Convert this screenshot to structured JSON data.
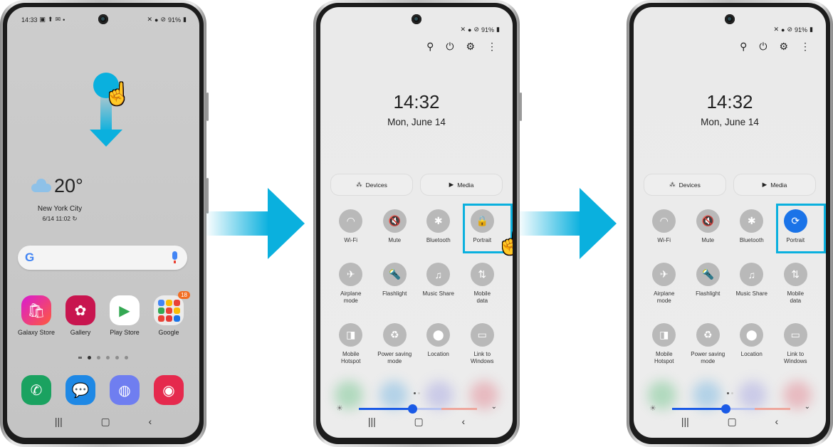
{
  "colors": {
    "accent": "#0ab0de",
    "toggle_on": "#1a73e8",
    "badge": "#f26d22"
  },
  "phone1": {
    "status_time": "14:33",
    "status_icons_left": [
      "image-icon",
      "upload-icon",
      "mail-icon",
      "dot-icon"
    ],
    "status_right": "91%",
    "gesture": "swipe-down",
    "weather": {
      "temp": "20°",
      "city": "New York City",
      "updated": "6/14 11:02"
    },
    "apps": [
      {
        "label": "Galaxy Store",
        "icon": "bag-icon",
        "color": "#e3336f"
      },
      {
        "label": "Gallery",
        "icon": "flower-icon",
        "color": "#c8154f"
      },
      {
        "label": "Play Store",
        "icon": "play-icon",
        "color": "#ffffff"
      },
      {
        "label": "Google",
        "icon": "folder-icon",
        "color": "#eeeeee",
        "badge": "18"
      }
    ],
    "dock": [
      {
        "icon": "phone-icon",
        "color": "#1aa260"
      },
      {
        "icon": "messages-icon",
        "color": "#1e88e5"
      },
      {
        "icon": "internet-icon",
        "color": "#6f7ef0"
      },
      {
        "icon": "camera-icon",
        "color": "#e5294d"
      }
    ]
  },
  "panel": {
    "status_right": "91%",
    "clock": "14:32",
    "date": "Mon, June 14",
    "devices_label": "Devices",
    "media_label": "Media",
    "brightness": 0.45,
    "tiles": [
      {
        "label": "Wi-Fi",
        "glyph": "◠"
      },
      {
        "label": "Mute",
        "glyph": "🔇"
      },
      {
        "label": "Bluetooth",
        "glyph": "✱"
      },
      {
        "label": "Portrait",
        "glyph": "🔒"
      },
      {
        "label": "Airplane\nmode",
        "glyph": "✈"
      },
      {
        "label": "Flashlight",
        "glyph": "🔦"
      },
      {
        "label": "Music Share",
        "glyph": "♫"
      },
      {
        "label": "Mobile\ndata",
        "glyph": "⇅"
      },
      {
        "label": "Mobile\nHotspot",
        "glyph": "◨"
      },
      {
        "label": "Power saving\nmode",
        "glyph": "♻"
      },
      {
        "label": "Location",
        "glyph": "⬤"
      },
      {
        "label": "Link to\nWindows",
        "glyph": "▭"
      }
    ]
  },
  "panel3_portrait_glyph": "⟳",
  "nav": {
    "recents": "|||",
    "home": "▢",
    "back": "‹"
  }
}
